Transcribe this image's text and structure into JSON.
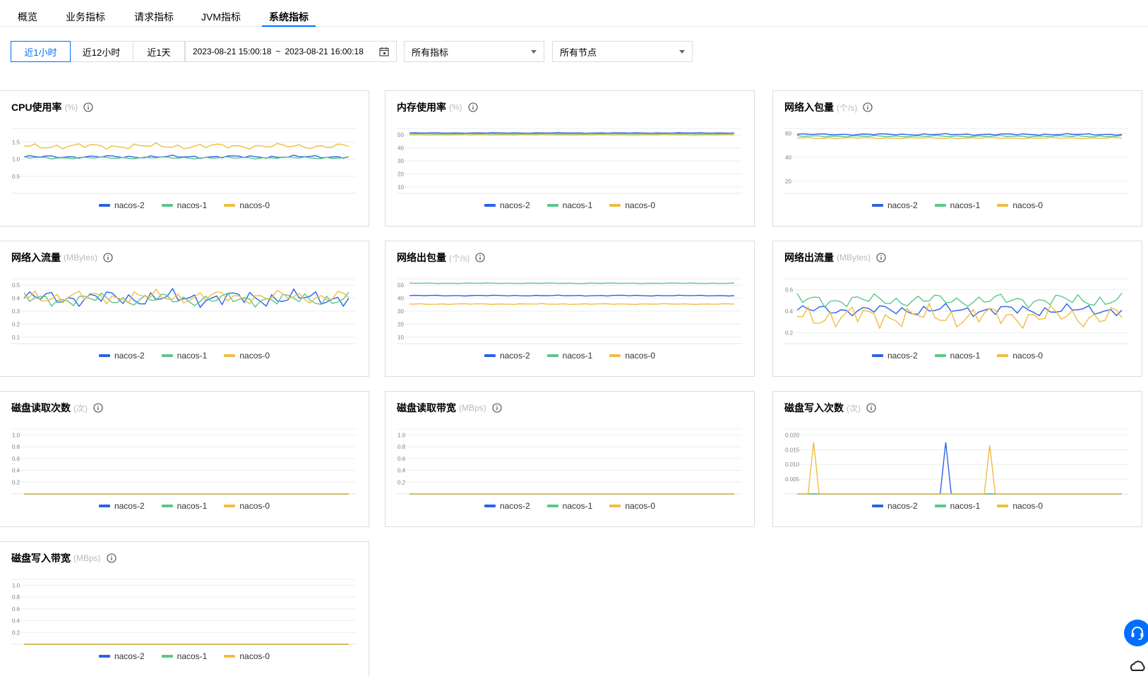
{
  "tabs": [
    "概览",
    "业务指标",
    "请求指标",
    "JVM指标",
    "系统指标"
  ],
  "active_tab": "系统指标",
  "toolbar": {
    "ranges": [
      "近1小时",
      "近12小时",
      "近1天"
    ],
    "active_range": "近1小时",
    "date_start": "2023-08-21 15:00:18",
    "date_sep": "~",
    "date_end": "2023-08-21 16:00:18",
    "metric_select": "所有指标",
    "node_select": "所有节点"
  },
  "colors": {
    "nacos-2": "#2b63e6",
    "nacos-1": "#5cc789",
    "nacos-0": "#f0bd44",
    "accent": "#006eff"
  },
  "legend": [
    "nacos-2",
    "nacos-1",
    "nacos-0"
  ],
  "chart_data": [
    {
      "type": "line",
      "title": "CPU使用率",
      "unit": "(%)",
      "yticks": [
        "1.5",
        "1.0",
        "0.5"
      ],
      "ylim": [
        0,
        1.9
      ],
      "series": [
        {
          "name": "nacos-2",
          "mean": 1.07,
          "amp": 0.04
        },
        {
          "name": "nacos-1",
          "mean": 1.04,
          "amp": 0.03
        },
        {
          "name": "nacos-0",
          "mean": 1.38,
          "amp": 0.08
        }
      ]
    },
    {
      "type": "line",
      "title": "内存使用率",
      "unit": "(%)",
      "yticks": [
        "50",
        "40",
        "30",
        "20",
        "10"
      ],
      "ylim": [
        5,
        55
      ],
      "series": [
        {
          "name": "nacos-2",
          "mean": 51.5,
          "amp": 0.2
        },
        {
          "name": "nacos-1",
          "mean": 50.8,
          "amp": 0.2
        },
        {
          "name": "nacos-0",
          "mean": 50.0,
          "amp": 0.2
        }
      ]
    },
    {
      "type": "line",
      "title": "网络入包量",
      "unit": "(个/s)",
      "yticks": [
        "60",
        "40",
        "20"
      ],
      "ylim": [
        10,
        64
      ],
      "series": [
        {
          "name": "nacos-2",
          "mean": 59,
          "amp": 0.6
        },
        {
          "name": "nacos-1",
          "mean": 57.5,
          "amp": 0.6
        },
        {
          "name": "nacos-0",
          "mean": 56,
          "amp": 0.6
        }
      ]
    },
    {
      "type": "line",
      "title": "网络入流量",
      "unit": "(MBytes)",
      "yticks": [
        "0.5",
        "0.4",
        "0.3",
        "0.2",
        "0.1"
      ],
      "ylim": [
        0.05,
        0.55
      ],
      "series": [
        {
          "name": "nacos-2",
          "mean": 0.4,
          "amp": 0.06
        },
        {
          "name": "nacos-1",
          "mean": 0.39,
          "amp": 0.05
        },
        {
          "name": "nacos-0",
          "mean": 0.41,
          "amp": 0.05
        }
      ]
    },
    {
      "type": "line",
      "title": "网络出包量",
      "unit": "(个/s)",
      "yticks": [
        "50",
        "40",
        "30",
        "20",
        "10"
      ],
      "ylim": [
        5,
        55
      ],
      "series": [
        {
          "name": "nacos-2",
          "mean": 42,
          "amp": 0.3
        },
        {
          "name": "nacos-1",
          "mean": 51.5,
          "amp": 0.2
        },
        {
          "name": "nacos-0",
          "mean": 35.5,
          "amp": 0.3
        }
      ]
    },
    {
      "type": "line",
      "title": "网络出流量",
      "unit": "(MBytes)",
      "yticks": [
        "0.6",
        "0.4",
        "0.2"
      ],
      "ylim": [
        0.1,
        0.7
      ],
      "series": [
        {
          "name": "nacos-2",
          "mean": 0.41,
          "amp": 0.05
        },
        {
          "name": "nacos-1",
          "mean": 0.5,
          "amp": 0.06
        },
        {
          "name": "nacos-0",
          "mean": 0.35,
          "amp": 0.1
        }
      ]
    },
    {
      "type": "line",
      "title": "磁盘读取次数",
      "unit": "(次)",
      "yticks": [
        "1.0",
        "0.8",
        "0.6",
        "0.4",
        "0.2"
      ],
      "ylim": [
        0,
        1.1
      ],
      "series": [
        {
          "name": "nacos-2",
          "mean": 0,
          "amp": 0
        },
        {
          "name": "nacos-1",
          "mean": 0,
          "amp": 0
        },
        {
          "name": "nacos-0",
          "mean": 0,
          "amp": 0
        }
      ]
    },
    {
      "type": "line",
      "title": "磁盘读取带宽",
      "unit": "(MBps)",
      "yticks": [
        "1.0",
        "0.8",
        "0.6",
        "0.4",
        "0.2"
      ],
      "ylim": [
        0,
        1.1
      ],
      "series": [
        {
          "name": "nacos-2",
          "mean": 0,
          "amp": 0
        },
        {
          "name": "nacos-1",
          "mean": 0,
          "amp": 0
        },
        {
          "name": "nacos-0",
          "mean": 0,
          "amp": 0
        }
      ]
    },
    {
      "type": "line",
      "title": "磁盘写入次数",
      "unit": "(次)",
      "yticks": [
        "0.020",
        "0.015",
        "0.010",
        "0.005"
      ],
      "ylim": [
        0,
        0.022
      ],
      "series": [
        {
          "name": "nacos-2",
          "mean": 0,
          "amp": 0,
          "spikes": [
            [
              0.46,
              0.0175
            ]
          ]
        },
        {
          "name": "nacos-1",
          "mean": 0,
          "amp": 0
        },
        {
          "name": "nacos-0",
          "mean": 0,
          "amp": 0,
          "spikes": [
            [
              0.05,
              0.0175
            ],
            [
              0.6,
              0.0165
            ]
          ]
        }
      ]
    },
    {
      "type": "line",
      "title": "磁盘写入带宽",
      "unit": "(MBps)",
      "yticks": [
        "1.0",
        "0.8",
        "0.6",
        "0.4",
        "0.2"
      ],
      "ylim": [
        0,
        1.1
      ],
      "series": [
        {
          "name": "nacos-2",
          "mean": 0,
          "amp": 0
        },
        {
          "name": "nacos-1",
          "mean": 0,
          "amp": 0
        },
        {
          "name": "nacos-0",
          "mean": 0,
          "amp": 0
        }
      ]
    }
  ]
}
